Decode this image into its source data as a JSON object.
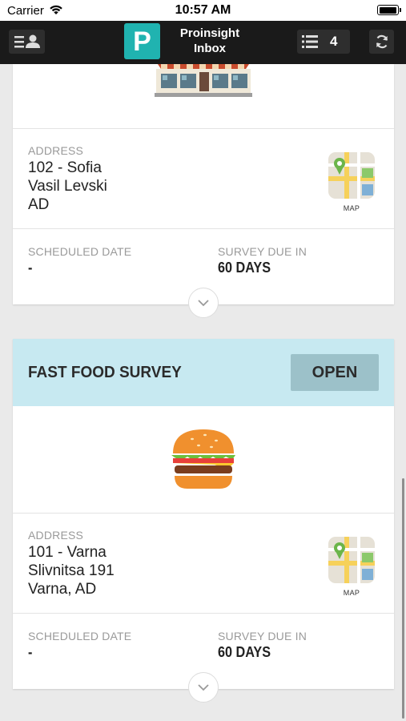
{
  "status_bar": {
    "carrier": "Carrier",
    "time": "10:57 AM"
  },
  "nav": {
    "logo_letter": "P",
    "title_line1": "Proinsight",
    "title_line2": "Inbox",
    "count": "4",
    "accent": "#20b3b0"
  },
  "surveys": [
    {
      "address_label": "ADDRESS",
      "address_lines": [
        "102 - Sofia",
        "Vasil Levski",
        "AD"
      ],
      "map_label": "MAP",
      "scheduled_label": "SCHEDULED DATE",
      "scheduled_value": "-",
      "due_label": "SURVEY DUE IN",
      "due_value": "60 DAYS",
      "image": "store-icon"
    },
    {
      "title": "FAST FOOD SURVEY",
      "action_label": "OPEN",
      "address_label": "ADDRESS",
      "address_lines": [
        "101 - Varna",
        "Slivnitsa 191",
        "Varna, AD"
      ],
      "map_label": "MAP",
      "scheduled_label": "SCHEDULED DATE",
      "scheduled_value": "-",
      "due_label": "SURVEY DUE IN",
      "due_value": "60 DAYS",
      "image": "burger-icon"
    }
  ]
}
